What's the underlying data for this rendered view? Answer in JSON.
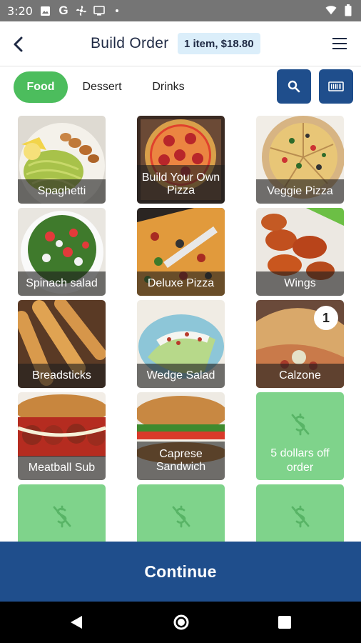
{
  "status_bar": {
    "time": "3:20",
    "icons": [
      "image-icon",
      "google-g-icon",
      "fan-icon",
      "cast-icon",
      "notification-dot",
      "wifi-icon",
      "battery-icon"
    ],
    "g_letter": "G"
  },
  "header": {
    "title": "Build Order",
    "order_summary": "1 item, $18.80"
  },
  "tabs": [
    {
      "label": "Food",
      "active": true
    },
    {
      "label": "Dessert",
      "active": false
    },
    {
      "label": "Drinks",
      "active": false
    }
  ],
  "menu_items": [
    {
      "label": "Spaghetti"
    },
    {
      "label": "Build Your Own Pizza"
    },
    {
      "label": "Veggie Pizza"
    },
    {
      "label": "Spinach salad"
    },
    {
      "label": "Deluxe Pizza"
    },
    {
      "label": "Wings"
    },
    {
      "label": "Breadsticks"
    },
    {
      "label": "Wedge Salad"
    },
    {
      "label": "Calzone",
      "quantity": "1"
    },
    {
      "label": "Meatball Sub"
    },
    {
      "label": "Caprese Sandwich"
    }
  ],
  "promos": [
    {
      "label": "5 dollars off order",
      "icon": "dollar-off-icon"
    }
  ],
  "continue_label": "Continue",
  "colors": {
    "primary": "#1f4e8c",
    "accent_green": "#4cbd5d",
    "promo_green": "#7fd38b",
    "badge_bg": "#dbeefa"
  }
}
